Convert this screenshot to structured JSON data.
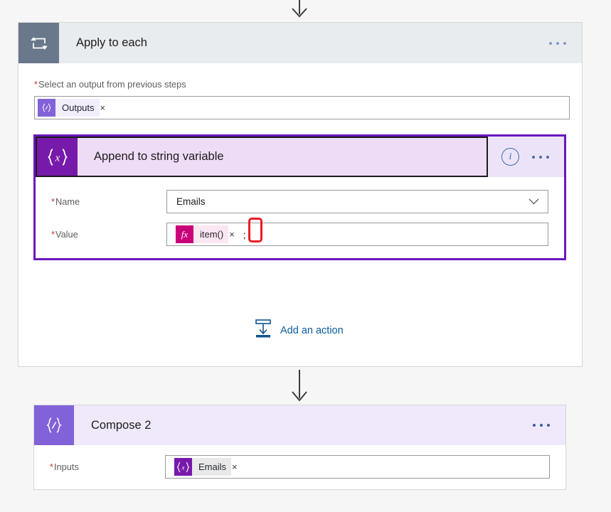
{
  "colors": {
    "page_background": "#f6f6f6",
    "scope_header": "#e8ecee",
    "scope_icon": "#69788a",
    "selection_border": "#6b16be",
    "variable_purple": "#7719aa",
    "compose_purple": "#8262d8",
    "expression_magenta": "#c9007a",
    "annotation_red": "#ee1b24",
    "link_blue": "#0a5a9c",
    "required_asterisk": "#c0392b"
  },
  "scope": {
    "icon": "loop-repeat-icon",
    "title": "Apply to each",
    "overflow_menu": "...",
    "foreach_field": {
      "label": "Select an output from previous steps",
      "required_marker": "*",
      "token": {
        "icon": "compose-icon",
        "text": "Outputs",
        "remove": "×"
      }
    }
  },
  "action": {
    "icon": "variables-icon",
    "icon_glyph": "{x}",
    "title": "Append to string variable",
    "info_icon": "info-circle-icon",
    "overflow_menu": "...",
    "selected": true,
    "parameters": [
      {
        "label": "Name",
        "required_marker": "*",
        "kind": "dropdown",
        "value": "Emails",
        "chevron": "chevron-down-icon"
      },
      {
        "label": "Value",
        "required_marker": "*",
        "kind": "token-field",
        "token": {
          "icon": "expression-fx-icon",
          "icon_glyph": "fx",
          "text": "item()",
          "remove": "×"
        },
        "trailing_text": ";",
        "annotated": true
      }
    ]
  },
  "add_action": {
    "icon": "add-action-icon",
    "label": "Add an action"
  },
  "compose": {
    "icon": "compose-icon",
    "icon_glyph": "{/}",
    "title": "Compose 2",
    "overflow_menu": "...",
    "inputs_field": {
      "label": "Inputs",
      "required_marker": "*",
      "token": {
        "icon": "variables-icon",
        "icon_glyph": "{x}",
        "text": "Emails",
        "remove": "×"
      }
    }
  },
  "connectors": [
    {
      "name": "connector-top",
      "direction": "down"
    },
    {
      "name": "connector-scope-to-compose",
      "direction": "down"
    }
  ]
}
